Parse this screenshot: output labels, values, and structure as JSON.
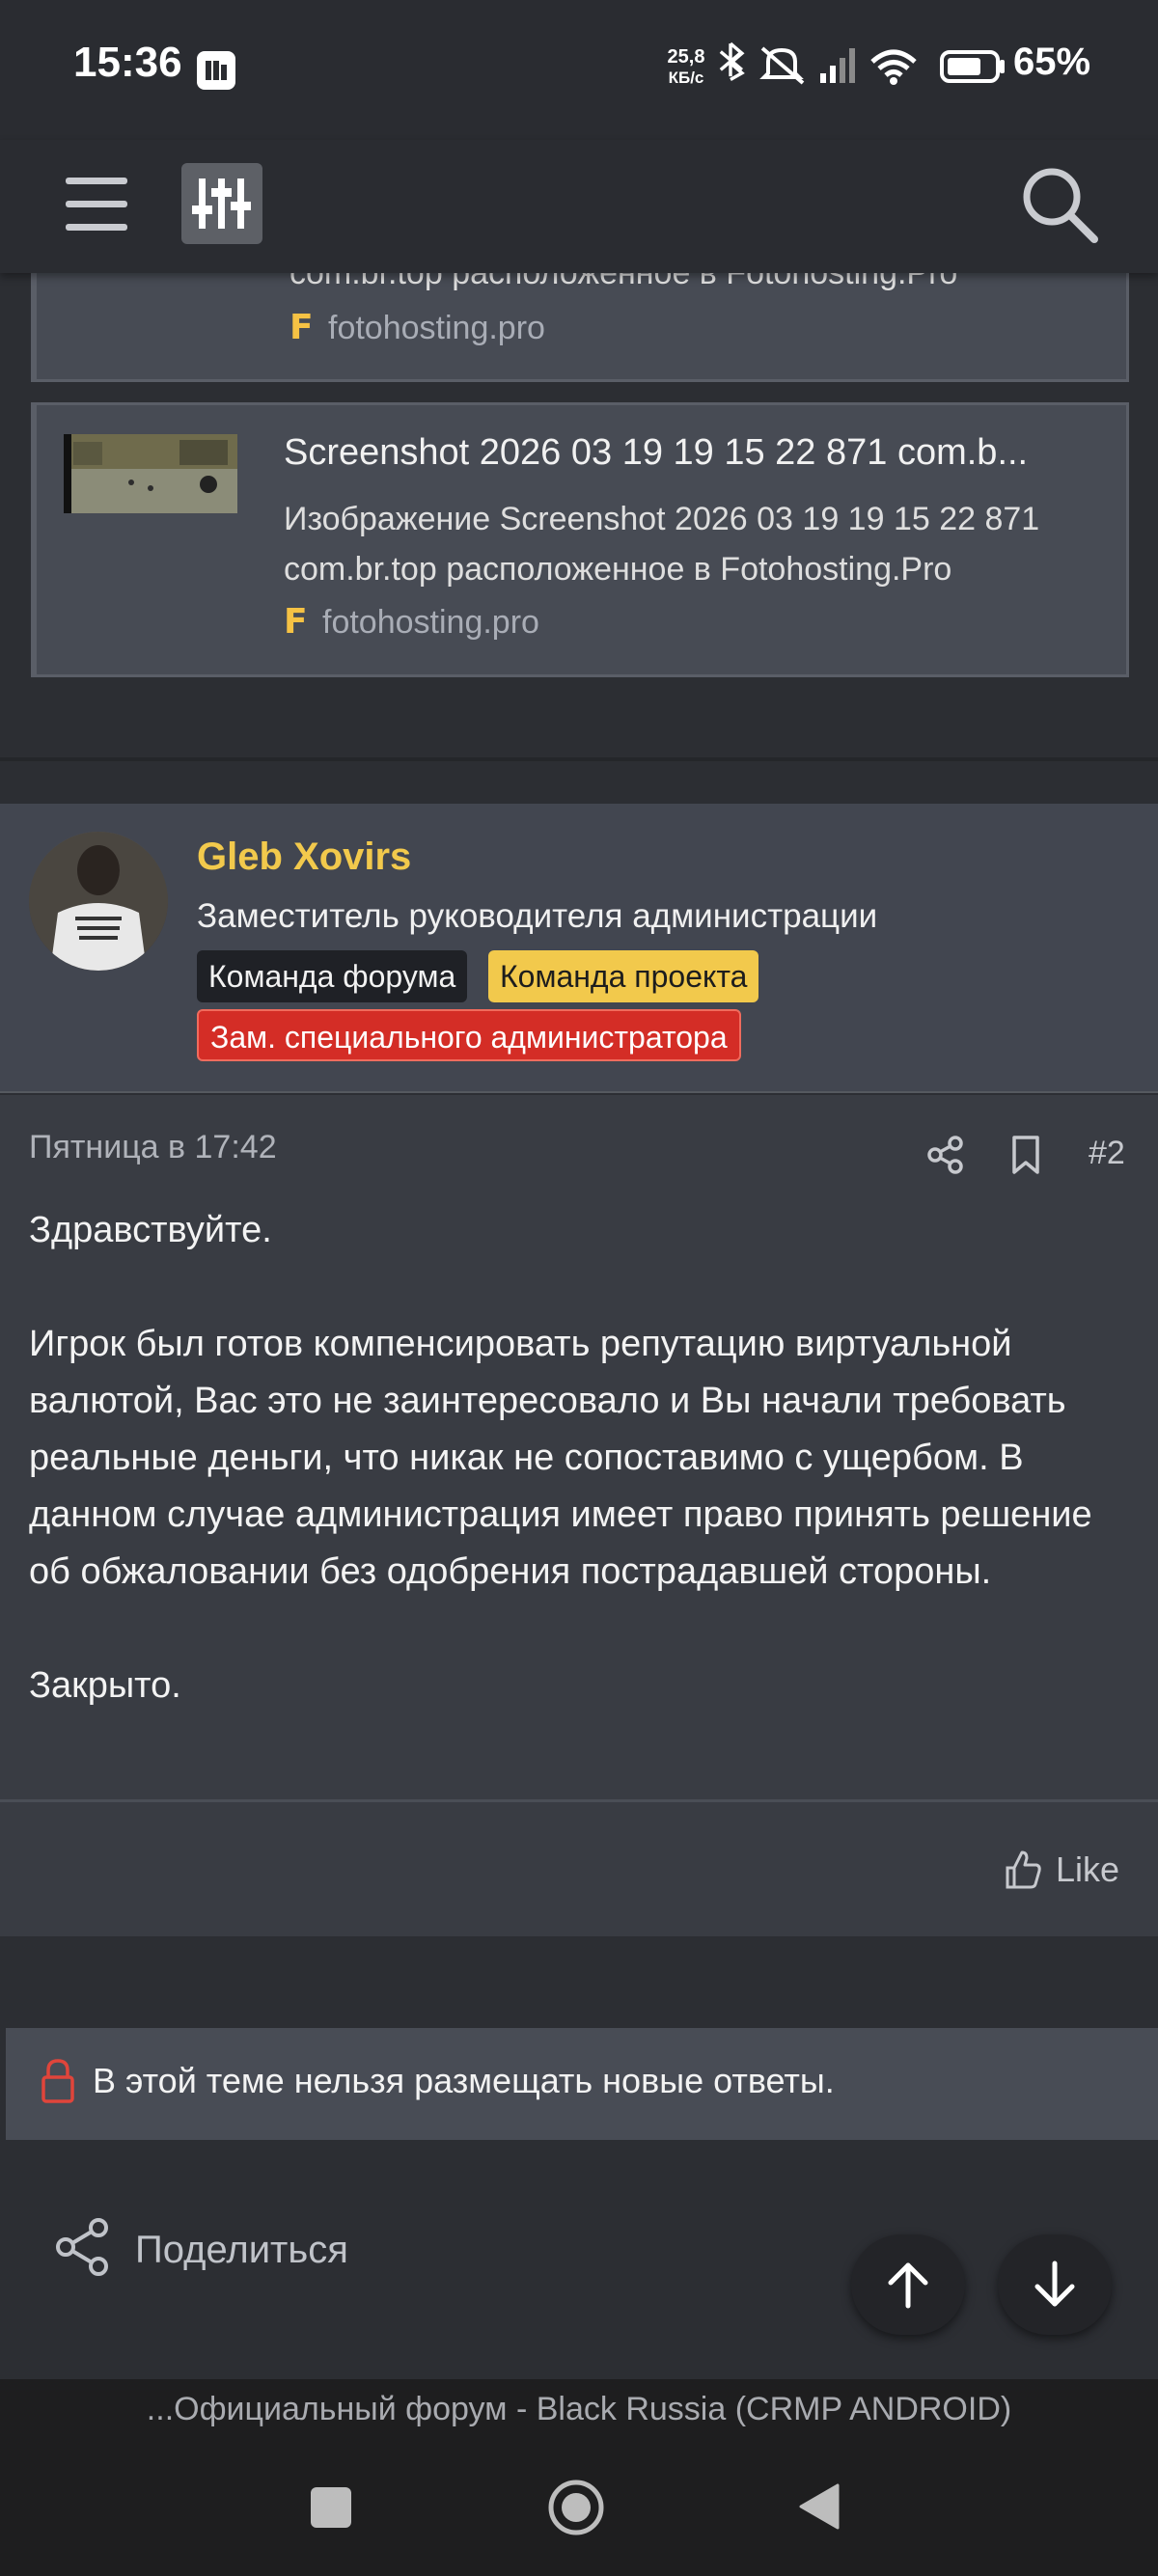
{
  "status_bar": {
    "time": "15:36",
    "net_speed_value": "25,8",
    "net_speed_unit": "КБ/с",
    "battery": "65%"
  },
  "header": {
    "icons": [
      "menu-icon",
      "filter-sliders-icon",
      "search-icon"
    ]
  },
  "link_previews": [
    {
      "description_partial": "com.br.top расположенное в Fotohosting.Pro",
      "domain": "fotohosting.pro"
    },
    {
      "title": "Screenshot 2026 03 19 19 15 22 871 com.b...",
      "description_line1": "Изображение Screenshot 2026 03 19 19 15 22 871",
      "description_line2": "com.br.top расположенное в Fotohosting.Pro",
      "domain": "fotohosting.pro"
    }
  ],
  "author": {
    "name": "Gleb Xovirs",
    "title": "Заместитель руководителя администрации",
    "badges": [
      "Команда форума",
      "Команда проекта",
      "Зам. специального администратора"
    ]
  },
  "post": {
    "date": "Пятница в 17:42",
    "number": "#2",
    "paragraphs": [
      "Здравствуйте.",
      "Игрок был готов компенсировать репутацию виртуальной валютой, Вас это не заинтересовало и Вы начали требовать реальные деньги, что никак не сопоставимо с ущербом. В данном случае администрация имеет право принять решение об обжаловании без одобрения пострадавшей стороны.",
      "Закрыто."
    ],
    "like_label": "Like"
  },
  "thread": {
    "locked_notice": "В этой теме нельзя размещать новые ответы.",
    "share_label": "Поделиться"
  },
  "footer": {
    "page_title": "...Официальный форум - Black Russia (CRMP ANDROID)"
  },
  "colors": {
    "accent_name": "#f2c94c",
    "badge_red": "#d42d26",
    "lock_red": "#e0453b"
  }
}
